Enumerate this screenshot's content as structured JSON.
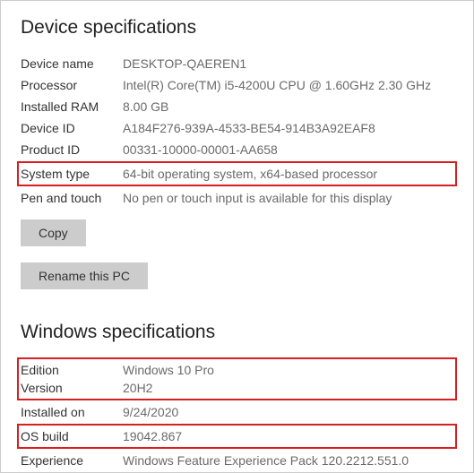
{
  "device": {
    "heading": "Device specifications",
    "name_label": "Device name",
    "name_value": "DESKTOP-QAEREN1",
    "processor_label": "Processor",
    "processor_value": "Intel(R) Core(TM) i5-4200U CPU @ 1.60GHz   2.30 GHz",
    "ram_label": "Installed RAM",
    "ram_value": "8.00 GB",
    "device_id_label": "Device ID",
    "device_id_value": "A184F276-939A-4533-BE54-914B3A92EAF8",
    "product_id_label": "Product ID",
    "product_id_value": "00331-10000-00001-AA658",
    "system_type_label": "System type",
    "system_type_value": "64-bit operating system, x64-based processor",
    "pen_touch_label": "Pen and touch",
    "pen_touch_value": "No pen or touch input is available for this display",
    "copy_btn": "Copy",
    "rename_btn": "Rename this PC"
  },
  "windows": {
    "heading": "Windows specifications",
    "edition_label": "Edition",
    "edition_value": "Windows 10 Pro",
    "version_label": "Version",
    "version_value": "20H2",
    "installed_label": "Installed on",
    "installed_value": "9/24/2020",
    "os_build_label": "OS build",
    "os_build_value": "19042.867",
    "experience_label": "Experience",
    "experience_value": "Windows Feature Experience Pack 120.2212.551.0"
  }
}
